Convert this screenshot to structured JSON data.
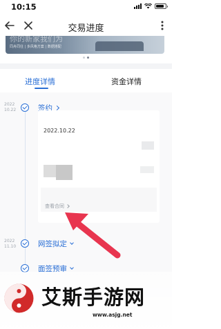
{
  "status_bar": {
    "time": "10:15"
  },
  "nav": {
    "title": "交易进度"
  },
  "banner": {
    "headline": "你的新家我们为",
    "subtitle": "同舟同往 | 多风格方案 | 数据搭配"
  },
  "tabs": [
    {
      "label": "进度详情",
      "active": true
    },
    {
      "label": "资金详情",
      "active": false
    }
  ],
  "timeline": {
    "steps": [
      {
        "date": "2022\n10.22",
        "label": "签约",
        "expanded": true
      },
      {
        "date": "2022\n11.10",
        "label": "网签拟定",
        "expanded": false
      },
      {
        "date": "",
        "label": "面签预审",
        "expanded": false
      }
    ],
    "detail_card": {
      "date": "2022.10.22",
      "link": "查看合同"
    }
  },
  "watermark": {
    "title": "艾斯手游网",
    "url": "www.asjg.net"
  },
  "colors": {
    "accent": "#2a6fd6",
    "arrow": "#e8354f"
  }
}
